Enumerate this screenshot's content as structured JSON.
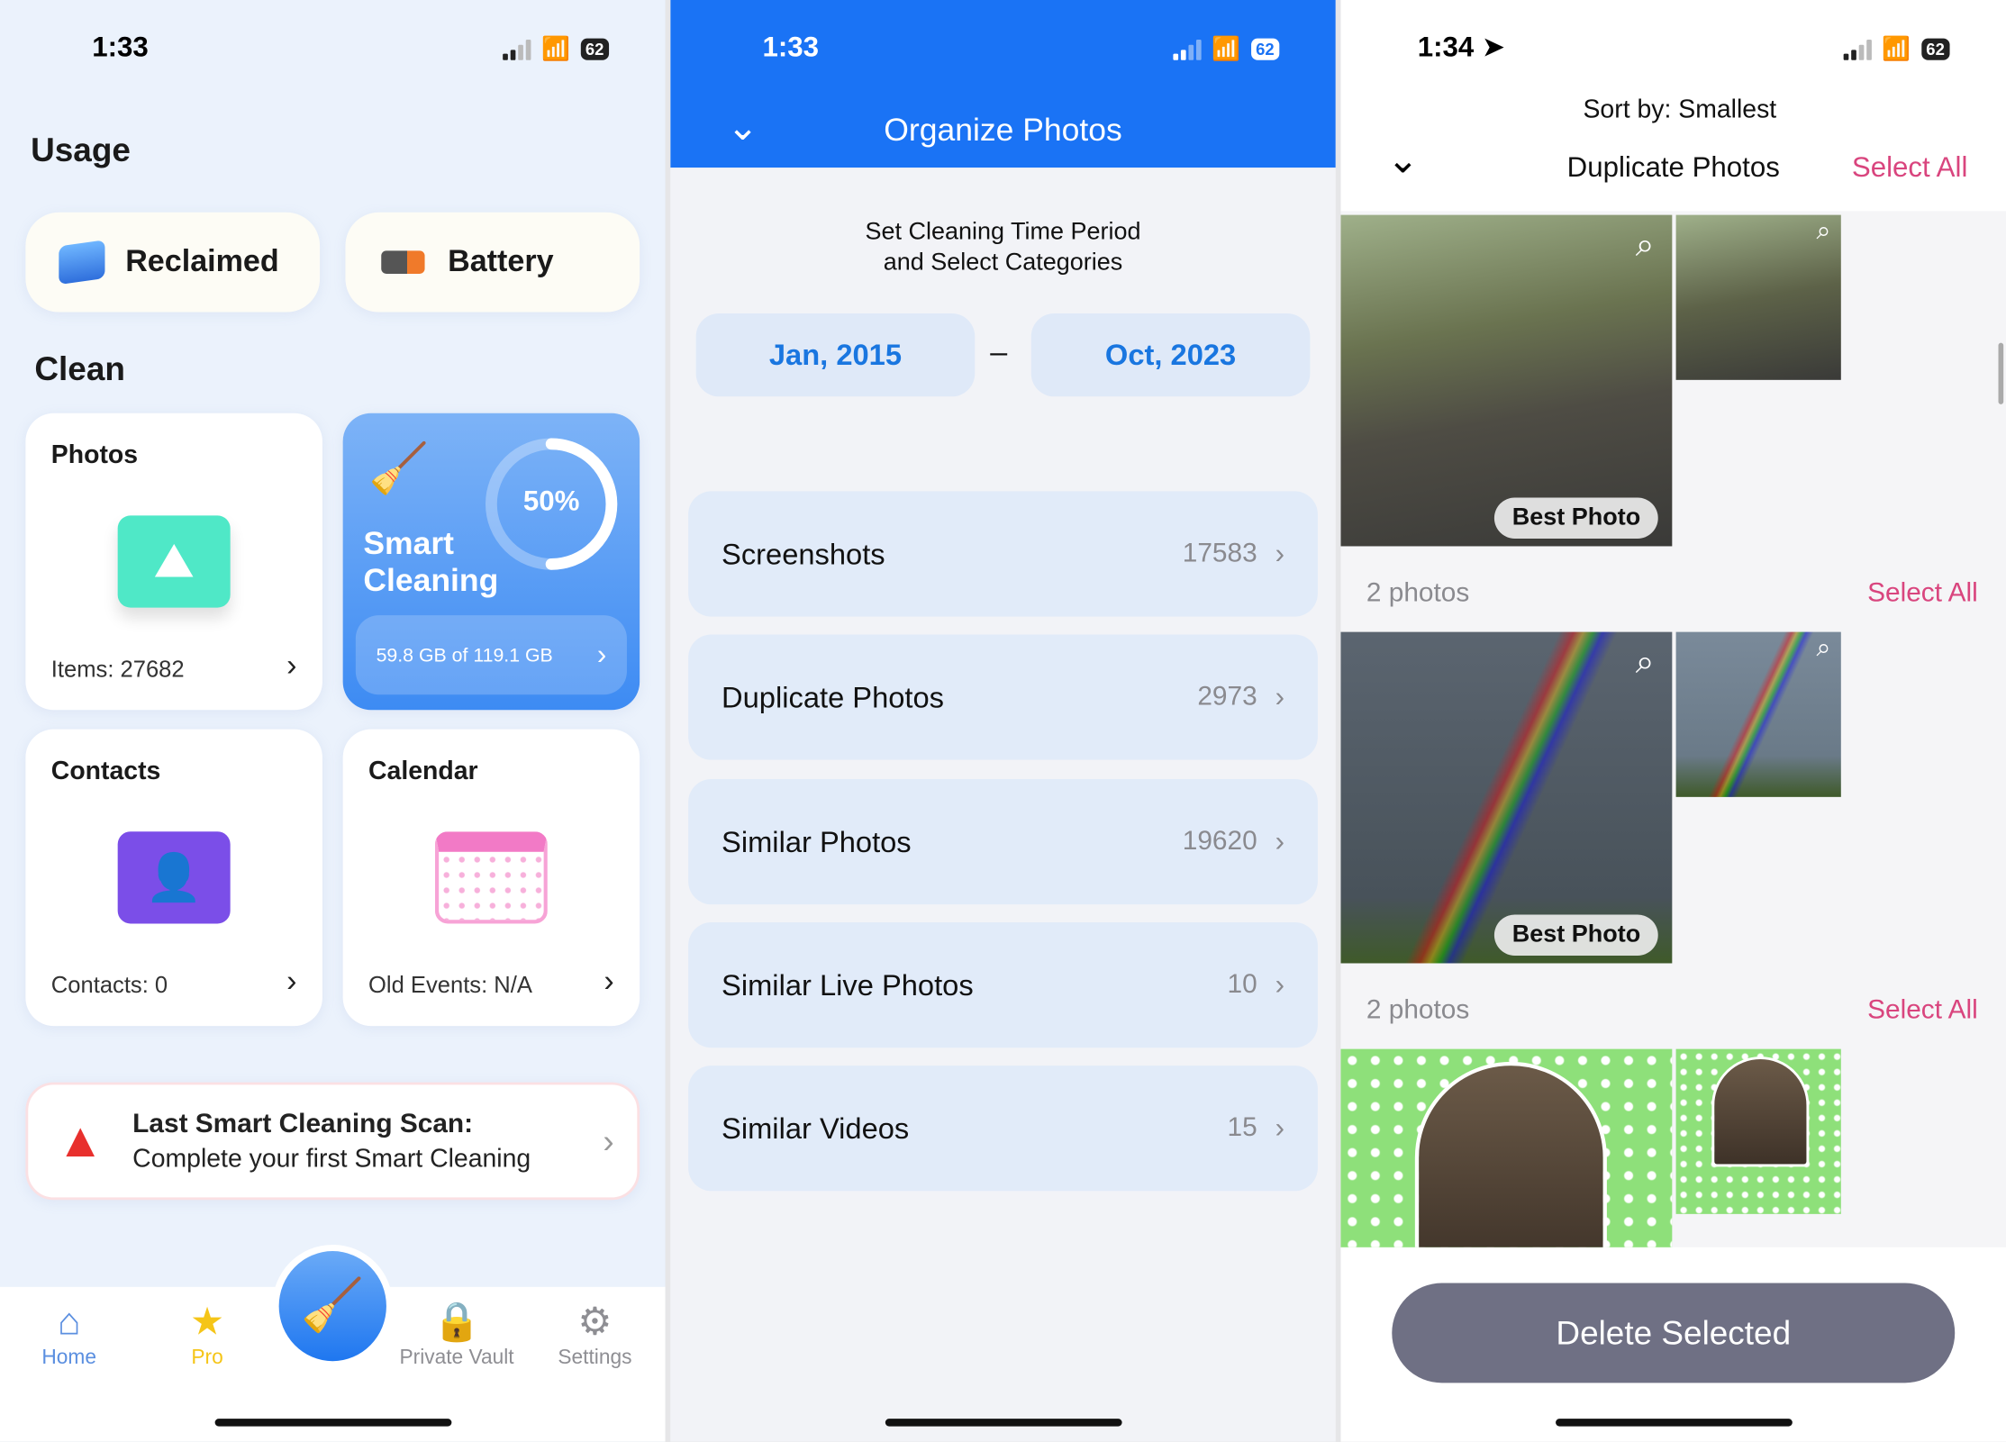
{
  "screen1": {
    "time": "1:33",
    "battery": "62",
    "usage_title": "Usage",
    "usage_buttons": [
      {
        "label": "Reclaimed",
        "icon": "layers-icon"
      },
      {
        "label": "Battery",
        "icon": "battery-icon"
      }
    ],
    "clean_title": "Clean",
    "photos": {
      "title": "Photos",
      "detail": "Items: 27682"
    },
    "smart": {
      "title_line1": "Smart",
      "title_line2": "Cleaning",
      "percent": "50%",
      "percent_value": 50,
      "storage": "59.8 GB of 119.1 GB"
    },
    "contacts": {
      "title": "Contacts",
      "detail": "Contacts: 0"
    },
    "calendar": {
      "title": "Calendar",
      "detail": "Old Events: N/A"
    },
    "scan": {
      "title": "Last Smart Cleaning Scan:",
      "subtitle": "Complete your first Smart Cleaning"
    },
    "tabs": [
      {
        "label": "Home",
        "icon": "home-icon",
        "color": "#5b8fe0"
      },
      {
        "label": "Pro",
        "icon": "star-icon",
        "color": "#f5c518"
      },
      {
        "label": "Private Vault",
        "icon": "lock-icon",
        "color": "#8e8e93"
      },
      {
        "label": "Settings",
        "icon": "gear-icon",
        "color": "#8e8e93"
      }
    ]
  },
  "screen2": {
    "time": "1:33",
    "battery": "62",
    "title": "Organize Photos",
    "instruction_line1": "Set Cleaning Time Period",
    "instruction_line2": "and Select Categories",
    "start_date": "Jan, 2015",
    "separator": "–",
    "end_date": "Oct, 2023",
    "categories": [
      {
        "label": "Screenshots",
        "count": "17583"
      },
      {
        "label": "Duplicate Photos",
        "count": "2973"
      },
      {
        "label": "Similar Photos",
        "count": "19620"
      },
      {
        "label": "Similar Live Photos",
        "count": "10"
      },
      {
        "label": "Similar Videos",
        "count": "15"
      }
    ],
    "accent": "#1a73f5"
  },
  "screen3": {
    "time": "1:34",
    "battery": "62",
    "sort": "Sort by: Smallest",
    "title": "Duplicate Photos",
    "select_all": "Select All",
    "best_photo": "Best Photo",
    "groups": [
      {
        "count": "2 photos",
        "select_all": "Select All"
      },
      {
        "count": "2 photos",
        "select_all": "Select All"
      }
    ],
    "delete_button": "Delete Selected"
  }
}
